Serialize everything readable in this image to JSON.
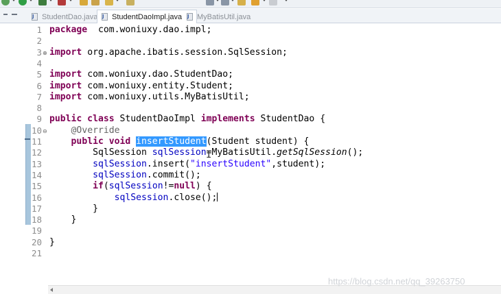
{
  "tabs": [
    {
      "label": "StudentDao.java",
      "active": false
    },
    {
      "label": "StudentDaoImpl.java",
      "active": true,
      "close": "✕"
    },
    {
      "label": "MyBatisUtil.java",
      "active": false
    }
  ],
  "code_lines": [
    {
      "n": "1",
      "tokens": [
        [
          "kw",
          "package"
        ],
        [
          "",
          "  com.woniuxy.dao.impl;"
        ]
      ]
    },
    {
      "n": "2",
      "tokens": []
    },
    {
      "n": "3",
      "fold": "⊕",
      "tokens": [
        [
          "kw",
          "import"
        ],
        [
          "",
          " org.apache.ibatis.session.SqlSession;"
        ]
      ]
    },
    {
      "n": "4",
      "tokens": []
    },
    {
      "n": "5",
      "tokens": [
        [
          "kw",
          "import"
        ],
        [
          "",
          " com.woniuxy.dao.StudentDao;"
        ]
      ]
    },
    {
      "n": "6",
      "tokens": [
        [
          "kw",
          "import"
        ],
        [
          "",
          " com.woniuxy.entity.Student;"
        ]
      ]
    },
    {
      "n": "7",
      "tokens": [
        [
          "kw",
          "import"
        ],
        [
          "",
          " com.woniuxy.utils.MyBatisUtil;"
        ]
      ]
    },
    {
      "n": "8",
      "tokens": []
    },
    {
      "n": "9",
      "tokens": [
        [
          "kw",
          "public class"
        ],
        [
          "",
          " StudentDaoImpl "
        ],
        [
          "kw",
          "implements"
        ],
        [
          "",
          " StudentDao {"
        ]
      ]
    },
    {
      "n": "10",
      "fold": "⊖",
      "tokens": [
        [
          "",
          "    "
        ],
        [
          "ann",
          "@Override"
        ]
      ]
    },
    {
      "n": "11",
      "tokens": [
        [
          "",
          "    "
        ],
        [
          "kw",
          "public void"
        ],
        [
          "",
          " "
        ],
        [
          "sel",
          "insertStudent"
        ],
        [
          "",
          "(Student student) {"
        ]
      ]
    },
    {
      "n": "12",
      "tokens": [
        [
          "",
          "        SqlSession "
        ],
        [
          "fld",
          "sqlSession"
        ],
        [
          "",
          "=MyBatisUtil."
        ],
        [
          "it",
          "getSqlSession"
        ],
        [
          "",
          "();"
        ]
      ]
    },
    {
      "n": "13",
      "tokens": [
        [
          "",
          "        "
        ],
        [
          "fld",
          "sqlSession"
        ],
        [
          ".",
          ".insert("
        ],
        [
          "str",
          "\"insertStudent\""
        ],
        [
          "",
          ",student);"
        ]
      ]
    },
    {
      "n": "14",
      "tokens": [
        [
          "",
          "        "
        ],
        [
          "fld",
          "sqlSession"
        ],
        [
          "",
          ".commit();"
        ]
      ]
    },
    {
      "n": "15",
      "tokens": [
        [
          "",
          "        "
        ],
        [
          "kw",
          "if"
        ],
        [
          "",
          "("
        ],
        [
          "fld",
          "sqlSession"
        ],
        [
          "",
          "!="
        ],
        [
          "kw",
          "null"
        ],
        [
          "",
          ") {"
        ]
      ]
    },
    {
      "n": "16",
      "tokens": [
        [
          "",
          "            "
        ],
        [
          "fld",
          "sqlSession"
        ],
        [
          "",
          ".close();"
        ],
        [
          "caret",
          ""
        ]
      ]
    },
    {
      "n": "17",
      "tokens": [
        [
          "",
          "        }"
        ]
      ]
    },
    {
      "n": "18",
      "tokens": [
        [
          "",
          "    }"
        ]
      ]
    },
    {
      "n": "19",
      "tokens": []
    },
    {
      "n": "20",
      "tokens": [
        [
          "",
          "}"
        ]
      ]
    },
    {
      "n": "21",
      "tokens": []
    }
  ],
  "watermark": "https://blog.csdn.net/qq_39263750"
}
